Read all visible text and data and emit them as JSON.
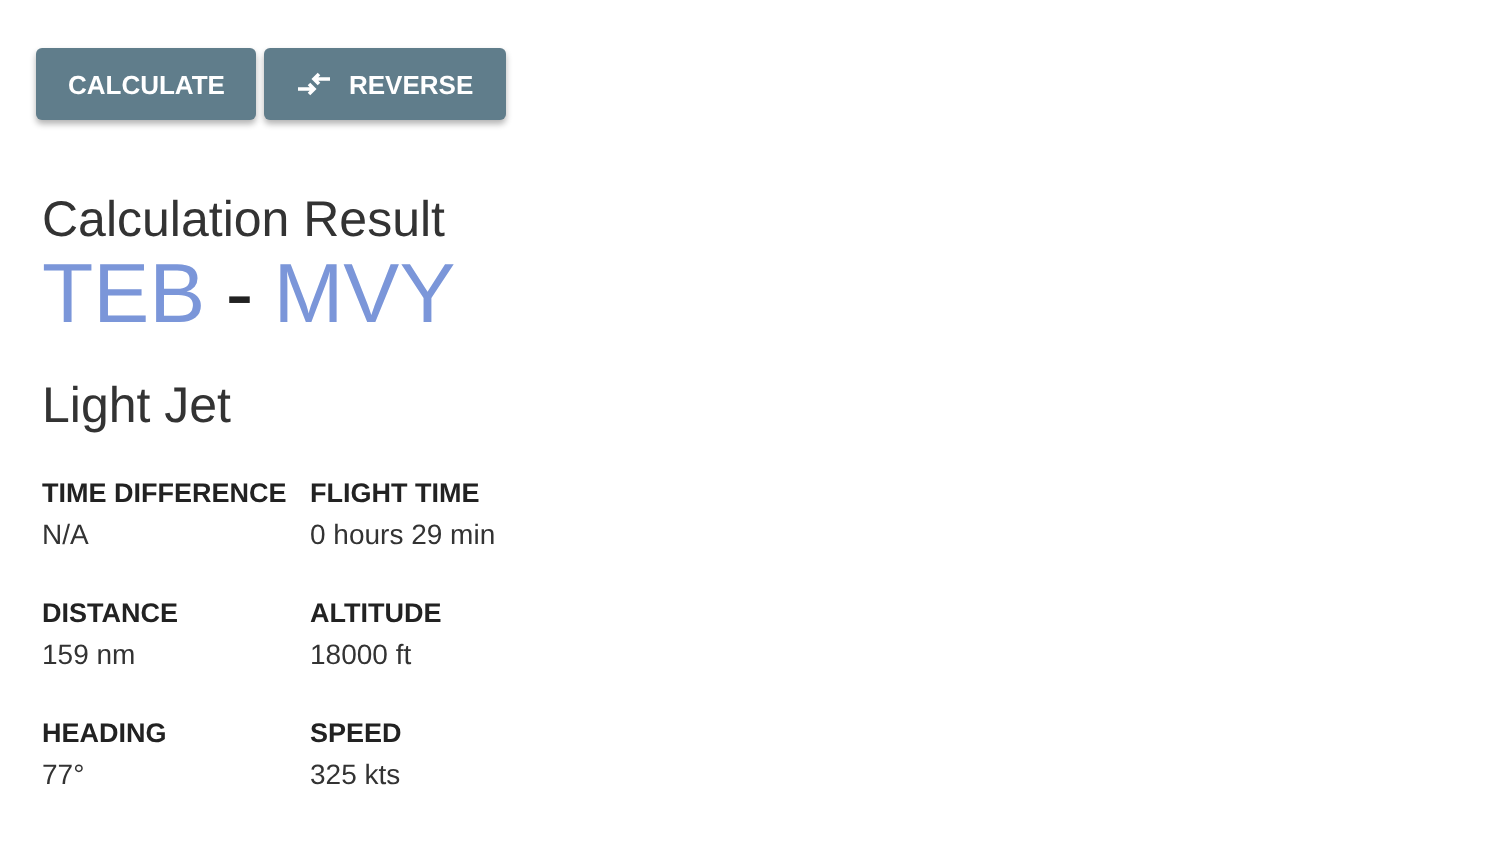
{
  "buttons": [
    {
      "label": "CALCULATE",
      "kind": "plain"
    },
    {
      "label": "REVERSE",
      "kind": "swap"
    }
  ],
  "result": {
    "heading": "Calculation Result",
    "route": {
      "from": "TEB",
      "separator": "-",
      "to": "MVY"
    },
    "aircraft": "Light Jet",
    "stats": [
      {
        "label": "TIME DIFFERENCE",
        "value": "N/A"
      },
      {
        "label": "FLIGHT TIME",
        "value": "0 hours 29 min"
      },
      {
        "label": "DISTANCE",
        "value": "159 nm"
      },
      {
        "label": "ALTITUDE",
        "value": "18000 ft"
      },
      {
        "label": "HEADING",
        "value": "77°"
      },
      {
        "label": "SPEED",
        "value": "325 kts"
      }
    ]
  }
}
